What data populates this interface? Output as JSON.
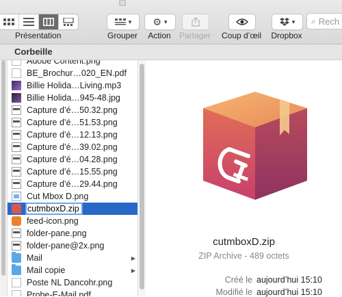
{
  "toolbar": {
    "presentation_label": "Présentation",
    "grouper_label": "Grouper",
    "action_label": "Action",
    "partager_label": "Partager",
    "coup_doeil_label": "Coup d’œil",
    "dropbox_label": "Dropbox",
    "search_placeholder": "Rech"
  },
  "pathbar": {
    "title": "Corbeille"
  },
  "files": [
    {
      "name": "Adobe Content.png",
      "icon": "document-icon"
    },
    {
      "name": "BE_Brochur…020_EN.pdf",
      "icon": "pdf-document-icon"
    },
    {
      "name": "Billie Holida…Living.mp3",
      "icon": "audio-file-icon"
    },
    {
      "name": "Billie Holida…945-48.jpg",
      "icon": "image-file-icon"
    },
    {
      "name": "Capture d’é…50.32.png",
      "icon": "screenshot-icon"
    },
    {
      "name": "Capture d’é…51.53.png",
      "icon": "screenshot-icon"
    },
    {
      "name": "Capture d’é…12.13.png",
      "icon": "screenshot-icon"
    },
    {
      "name": "Capture d’é…39.02.png",
      "icon": "screenshot-icon"
    },
    {
      "name": "Capture d’é…04.28.png",
      "icon": "screenshot-icon"
    },
    {
      "name": "Capture d’é…15.55.png",
      "icon": "screenshot-icon"
    },
    {
      "name": "Capture d’é…29.44.png",
      "icon": "screenshot-icon"
    },
    {
      "name": "Cut Mbox D.png",
      "icon": "image-file-icon"
    },
    {
      "name": "cutmboxD.zip",
      "icon": "zip-file-icon",
      "selected": true
    },
    {
      "name": "feed-icon.png",
      "icon": "rss-icon"
    },
    {
      "name": "folder-pane.png",
      "icon": "screenshot-icon"
    },
    {
      "name": "folder-pane@2x.png",
      "icon": "screenshot-icon"
    },
    {
      "name": "Mail",
      "icon": "folder-icon",
      "folder": true
    },
    {
      "name": "Mail copie",
      "icon": "folder-icon",
      "folder": true
    },
    {
      "name": "Poste NL Dancohr.png",
      "icon": "document-icon"
    },
    {
      "name": "Probe-E-Mail.pdf",
      "icon": "document-icon"
    }
  ],
  "preview": {
    "file_name": "cutmboxD.zip",
    "kind": "ZIP Archive - 489 octets",
    "created_label": "Créé le",
    "created_value": "aujourd’hui 15:10",
    "modified_label": "Modifié le",
    "modified_value": "aujourd’hui 15:10"
  },
  "colors": {
    "selection": "#2a68c8",
    "box_top": "#f0a26a",
    "box_left": "#d75a55",
    "box_right": "#a53a66"
  }
}
